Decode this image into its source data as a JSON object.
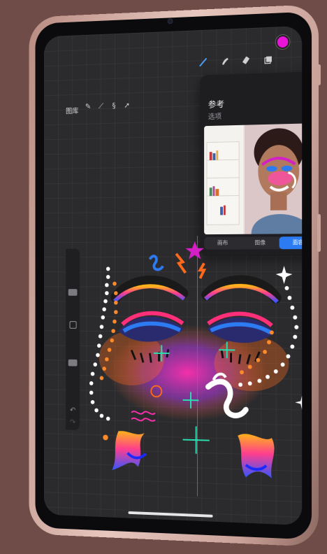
{
  "app": {
    "gallery_label": "图库"
  },
  "reference_panel": {
    "title": "参考",
    "subtitle": "选项",
    "tabs": [
      {
        "label": "画布",
        "active": false
      },
      {
        "label": "图像",
        "active": false
      },
      {
        "label": "面容",
        "active": true
      }
    ]
  },
  "toolbar_right": {
    "icons": [
      "brush-icon",
      "smudge-icon",
      "eraser-icon",
      "layers-icon"
    ],
    "active_color": "#e814d8"
  },
  "toolbar_left": {
    "icons": [
      "wrench-icon",
      "magic-wand-icon",
      "selection-icon",
      "transform-arrow-icon"
    ]
  },
  "colors": {
    "accent": "#2d7bf3",
    "device_frame": "#e7c7bf",
    "background": "#6f4c48"
  }
}
